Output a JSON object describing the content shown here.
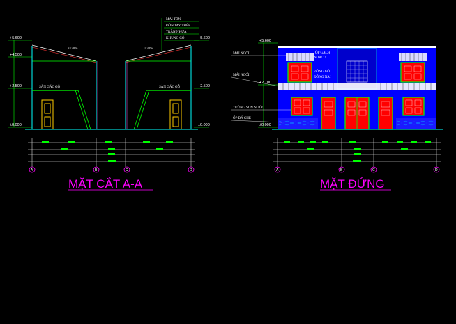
{
  "section": {
    "title": "MẶT CẮT A-A",
    "roof_notes": [
      "MÁI TÔN",
      "ĐÒN TAY THÉP",
      "TRẦN NHỰA",
      "KHUNG GỖ"
    ],
    "loft_labels": [
      "SÀN GÁC GỖ",
      "SÀN GÁC GỖ"
    ],
    "levels": {
      "top": "+5.600",
      "eave": "+4.500",
      "loft": "+2.500",
      "ground": "±0.000"
    },
    "levels_right": {
      "top": "+5.600",
      "loft": "+2.500",
      "ground": "±0.000"
    },
    "slope_left": "i=30%",
    "slope_right": "i=30%",
    "axes": [
      "A",
      "B",
      "C",
      "D"
    ]
  },
  "elevation": {
    "title": "MẶT ĐỨNG",
    "notes_left": [
      "MÁI NGÓI",
      "MÁI NGÓI",
      "TƯỜNG SƠN NƯỚC",
      "ỐP ĐÁ CHẺ"
    ],
    "notes_center": [
      "ỐP GẠCH",
      "NORCO",
      "ĐÔNG GỖ",
      "ĐỒNG NAI"
    ],
    "levels": {
      "top": "+5.600",
      "mid": "+2.700",
      "ground": "±0.000"
    },
    "axes": [
      "A",
      "B",
      "C",
      "D"
    ]
  },
  "colors": {
    "background": "#000000",
    "title": "#ff00ff",
    "wall_blue": "#0000ff",
    "door_red": "#ff0000",
    "green": "#00ff00",
    "yellow": "#ffcc00",
    "cyan": "#00ffff"
  }
}
